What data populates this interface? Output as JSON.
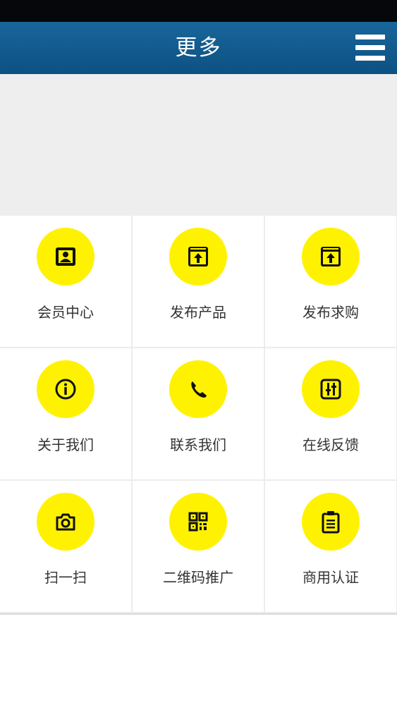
{
  "header": {
    "title": "更多",
    "menu_icon": "hamburger-menu-icon"
  },
  "colors": {
    "header": "#10588c",
    "icon_bg": "#fff200",
    "icon_fg": "#111111",
    "label": "#333333"
  },
  "grid": {
    "items": [
      {
        "label": "会员中心",
        "icon": "member-card-icon"
      },
      {
        "label": "发布产品",
        "icon": "upload-window-icon"
      },
      {
        "label": "发布求购",
        "icon": "upload-window-icon"
      },
      {
        "label": "关于我们",
        "icon": "info-icon"
      },
      {
        "label": "联系我们",
        "icon": "phone-icon"
      },
      {
        "label": "在线反馈",
        "icon": "sliders-icon"
      },
      {
        "label": "扫一扫",
        "icon": "camera-icon"
      },
      {
        "label": "二维码推广",
        "icon": "qr-code-icon"
      },
      {
        "label": "商用认证",
        "icon": "clipboard-icon"
      }
    ]
  }
}
